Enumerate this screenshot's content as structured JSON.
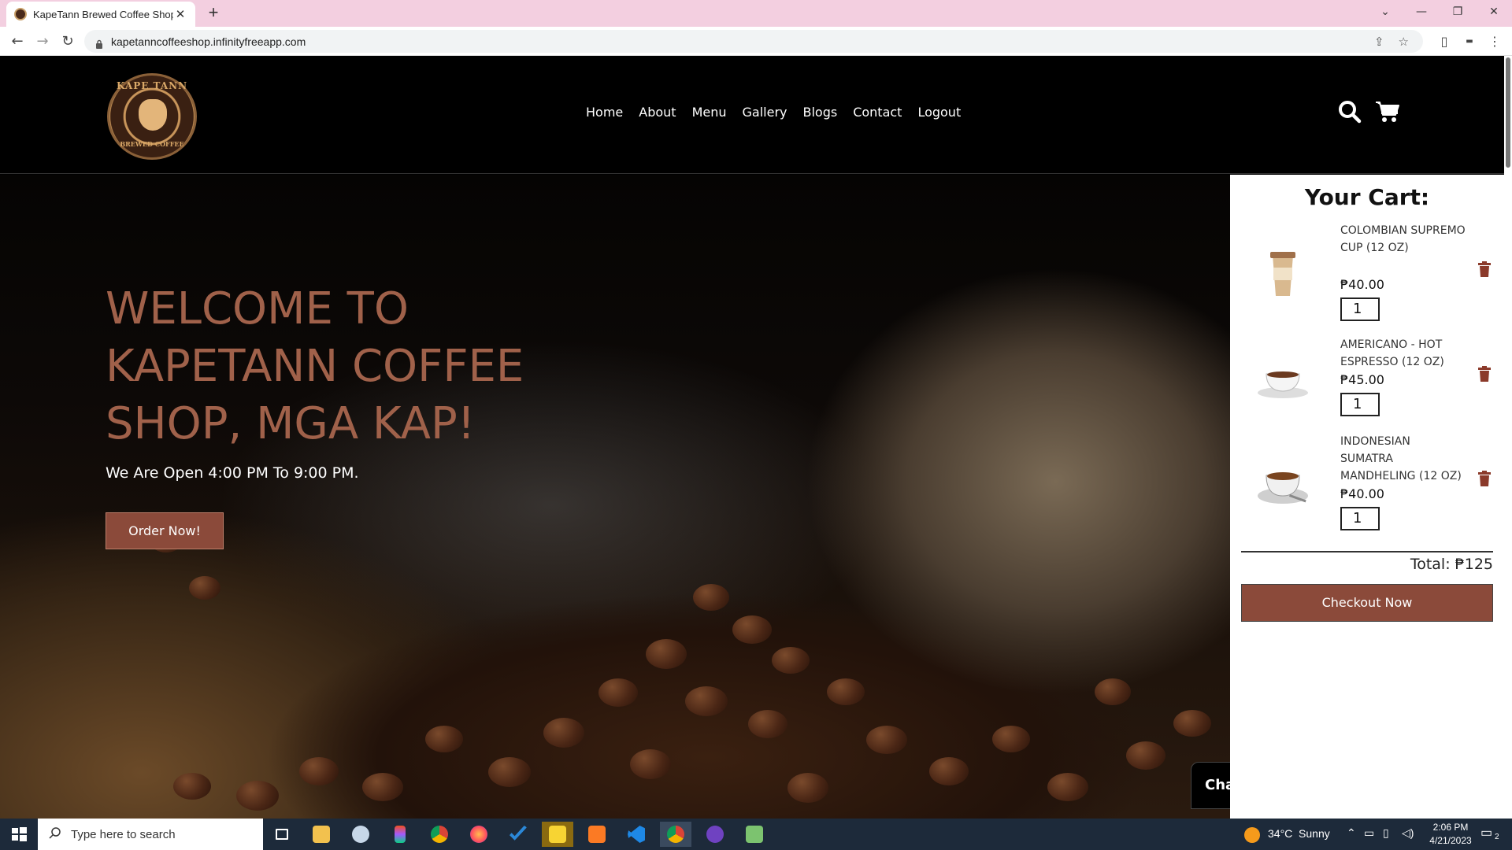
{
  "browser": {
    "tab_title": "KapeTann Brewed Coffee Shop",
    "url": "kapetanncoffeeshop.infinityfreeapp.com"
  },
  "site": {
    "nav": [
      "Home",
      "About",
      "Menu",
      "Gallery",
      "Blogs",
      "Contact",
      "Logout"
    ],
    "logo_top": "KAPE TANN",
    "logo_bottom": "BREWED COFFEE"
  },
  "hero": {
    "title": "WELCOME TO KAPETANN COFFEE SHOP, MGA KAP!",
    "subtitle": "We Are Open 4:00 PM To 9:00 PM.",
    "cta": "Order Now!",
    "chat_label": "Cha"
  },
  "cart": {
    "title": "Your Cart:",
    "items": [
      {
        "name": "COLOMBIAN SUPREMO CUP (12 OZ)",
        "price": "₱40.00",
        "qty": "1"
      },
      {
        "name": "AMERICANO - HOT ESPRESSO (12 OZ)",
        "price": "₱45.00",
        "qty": "1"
      },
      {
        "name": "INDONESIAN SUMATRA MANDHELING (12 OZ)",
        "price": "₱40.00",
        "qty": "1"
      }
    ],
    "total": "Total: ₱125",
    "checkout": "Checkout Now"
  },
  "taskbar": {
    "search_placeholder": "Type here to search",
    "weather": "34°C  Sunny",
    "time": "2:06 PM",
    "date": "4/21/2023",
    "notification_count": "2"
  },
  "colors": {
    "accent": "#8b4a3a",
    "hero_title": "#a0614a",
    "tabbar": "#f3cfe0"
  }
}
